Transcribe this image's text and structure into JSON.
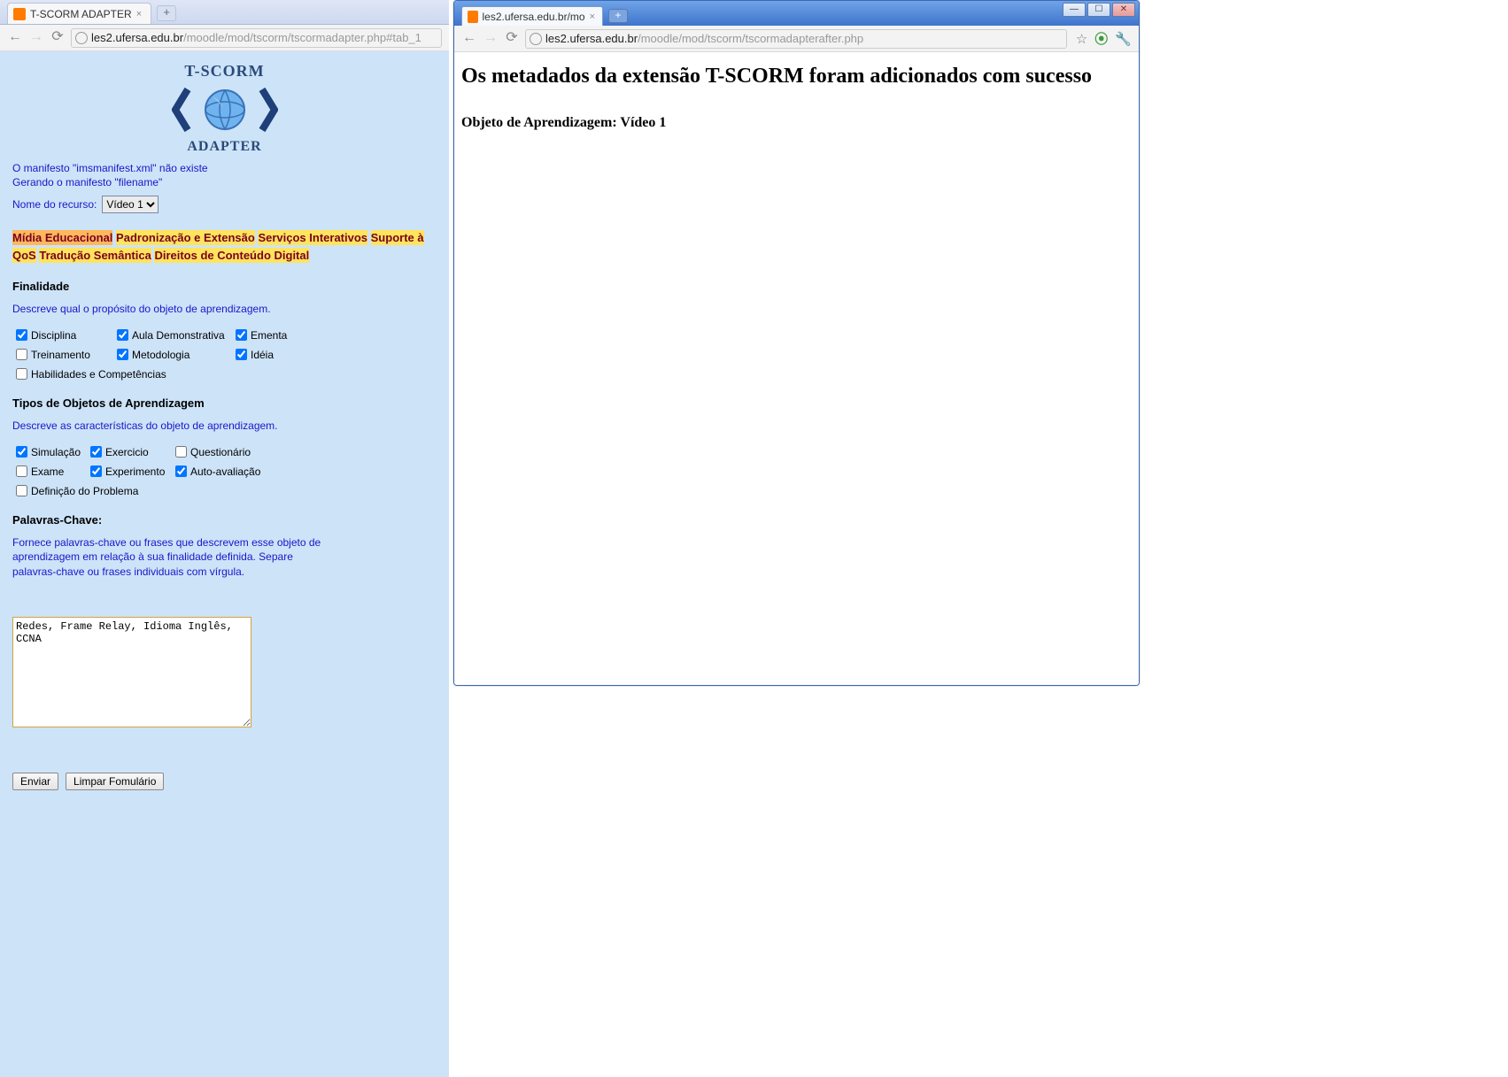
{
  "left": {
    "tab_title": "T-SCORM ADAPTER",
    "url_domain": "les2.ufersa.edu.br",
    "url_path": "/moodle/mod/tscorm/tscormadapter.php#tab_1",
    "logo_line1": "T-SCORM",
    "logo_line2": "ADAPTER",
    "status1": "O manifesto \"imsmanifest.xml\" não existe",
    "status2": "Gerando o manifesto \"filename\"",
    "resource_label": "Nome do recurso:",
    "resource_value": "Vídeo 1",
    "tab_links": [
      "Mídia Educacional",
      "Padronização e Extensão",
      "Serviços Interativos",
      "Suporte à QoS",
      "Tradução Semântica",
      "Direitos de Conteúdo Digital"
    ],
    "sec1_title": "Finalidade",
    "sec1_desc": "Descreve qual o propósito do objeto de aprendizagem.",
    "sec1_checks": [
      {
        "label": "Disciplina",
        "checked": true
      },
      {
        "label": "Aula Demonstrativa",
        "checked": true
      },
      {
        "label": "Ementa",
        "checked": true
      },
      {
        "label": "Treinamento",
        "checked": false
      },
      {
        "label": "Metodologia",
        "checked": true
      },
      {
        "label": "Idéia",
        "checked": true
      },
      {
        "label": "Habilidades e Competências",
        "checked": false
      }
    ],
    "sec2_title": "Tipos de Objetos de Aprendizagem",
    "sec2_desc": "Descreve as características do objeto de aprendizagem.",
    "sec2_checks": [
      {
        "label": "Simulação",
        "checked": true
      },
      {
        "label": "Exercicio",
        "checked": true
      },
      {
        "label": "Questionário",
        "checked": false
      },
      {
        "label": "Exame",
        "checked": false
      },
      {
        "label": "Experimento",
        "checked": true
      },
      {
        "label": "Auto-avaliação",
        "checked": true
      },
      {
        "label": "Definição do Problema",
        "checked": false
      }
    ],
    "sec3_title": "Palavras-Chave:",
    "sec3_desc": "Fornece palavras-chave ou frases que descrevem esse objeto de aprendizagem em relação à sua finalidade definida. Separe palavras-chave ou frases individuais com vírgula.",
    "keywords_value": "Redes, Frame Relay, Idioma Inglês, CCNA",
    "btn_submit": "Enviar",
    "btn_clear": "Limpar Fomulário"
  },
  "right": {
    "tab_title": "les2.ufersa.edu.br/mo",
    "url_domain": "les2.ufersa.edu.br",
    "url_path": "/moodle/mod/tscorm/tscormadapterafter.php",
    "heading": "Os metadados da extensão T-SCORM foram adicionados com sucesso",
    "subheading": "Objeto de Aprendizagem: Vídeo 1"
  }
}
